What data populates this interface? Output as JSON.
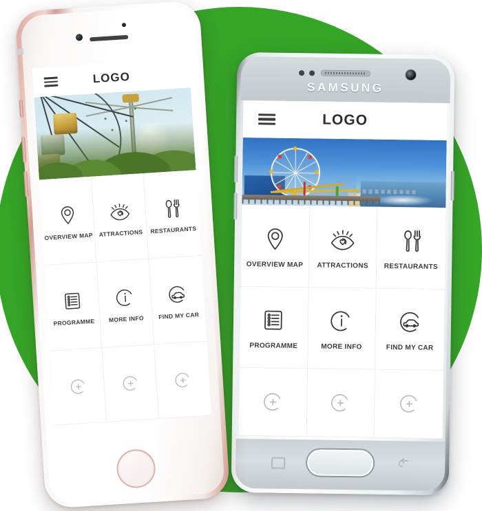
{
  "scene": {
    "background_color": "#ffffff",
    "accent_circle_color": "#35a526"
  },
  "devices": [
    {
      "id": "iphone",
      "name": "iphone-device",
      "frame_color": "#f5efec",
      "frame_accent_color": "#d9a79d",
      "brand_text": "",
      "hardware": {
        "home_button": "home-button",
        "speaker": "earpiece-speaker",
        "front_camera": "front-camera",
        "mute_switch": "mute-switch",
        "volume_up": "volume-up-button",
        "volume_down": "volume-down-button"
      }
    },
    {
      "id": "samsung",
      "name": "samsung-device",
      "frame_color": "#e9edef",
      "brand_text": "SAMSUNG",
      "hardware": {
        "home_button": "home-button",
        "recents_button": "recents-button",
        "back_button": "back-button",
        "earpiece": "earpiece-speaker",
        "front_camera": "front-camera",
        "sensors": "proximity-sensor",
        "volume_up": "volume-up-button",
        "volume_down": "volume-down-button",
        "power": "power-button"
      }
    }
  ],
  "app": {
    "header": {
      "menu_icon": "hamburger-menu-icon",
      "title": "LOGO"
    },
    "hero": {
      "iphone": {
        "name": "amusement-park-photo",
        "alt": "Amusement park chair swing ride and drop tower against pale sky with trees"
      },
      "samsung": {
        "name": "santa-monica-pier-photo",
        "alt": "Santa Monica Pier with Ferris wheel, roller coaster, beach and ocean"
      }
    },
    "tiles": [
      {
        "label": "OVERVIEW MAP",
        "icon": "map-pin-icon",
        "state": "active"
      },
      {
        "label": "ATTRACTIONS",
        "icon": "eye-icon",
        "state": "active"
      },
      {
        "label": "RESTAURANTS",
        "icon": "cutlery-icon",
        "state": "active"
      },
      {
        "label": "PROGRAMME",
        "icon": "checklist-icon",
        "state": "active"
      },
      {
        "label": "MORE INFO",
        "icon": "info-circle-icon",
        "state": "active"
      },
      {
        "label": "FIND MY CAR",
        "icon": "car-circle-icon",
        "state": "active"
      },
      {
        "label": "",
        "icon": "add-circle-icon",
        "state": "placeholder"
      },
      {
        "label": "",
        "icon": "add-circle-icon",
        "state": "placeholder"
      },
      {
        "label": "",
        "icon": "add-circle-icon",
        "state": "placeholder"
      }
    ],
    "colors": {
      "label_text": "#3a3a3a",
      "title_text": "#2e2e2e",
      "divider": "#eceeee",
      "placeholder_icon": "#b9bcbe"
    }
  }
}
